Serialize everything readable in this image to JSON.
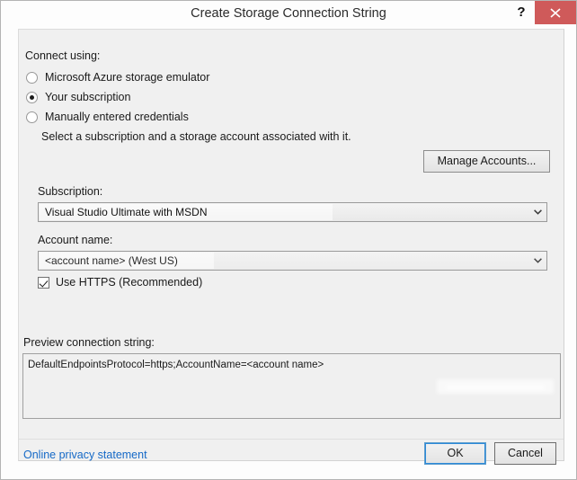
{
  "window": {
    "title": "Create Storage Connection String",
    "help_label": "?",
    "close_label": "close-icon"
  },
  "connect_using": {
    "label": "Connect using:",
    "options": [
      {
        "label": "Microsoft Azure storage emulator",
        "selected": false
      },
      {
        "label": "Your subscription",
        "selected": true
      },
      {
        "label": "Manually entered credentials",
        "selected": false
      }
    ]
  },
  "description": "Select a subscription and a storage account associated with it.",
  "manage_accounts": {
    "label": "Manage Accounts..."
  },
  "subscription": {
    "label": "Subscription:",
    "value": "Visual Studio Ultimate with MSDN"
  },
  "account_name": {
    "label": "Account name:",
    "value": "<account name> (West US)"
  },
  "use_https": {
    "label": "Use HTTPS (Recommended)",
    "checked": true
  },
  "preview": {
    "label": "Preview connection string:",
    "value": "DefaultEndpointsProtocol=https;AccountName=<account name>"
  },
  "footer": {
    "privacy_link": "Online privacy statement",
    "ok_label": "OK",
    "cancel_label": "Cancel"
  },
  "colors": {
    "close_button": "#cf5a5a",
    "panel_background": "#f0f0f0",
    "link": "#1569c7",
    "focus_border": "#2d8ad8"
  }
}
